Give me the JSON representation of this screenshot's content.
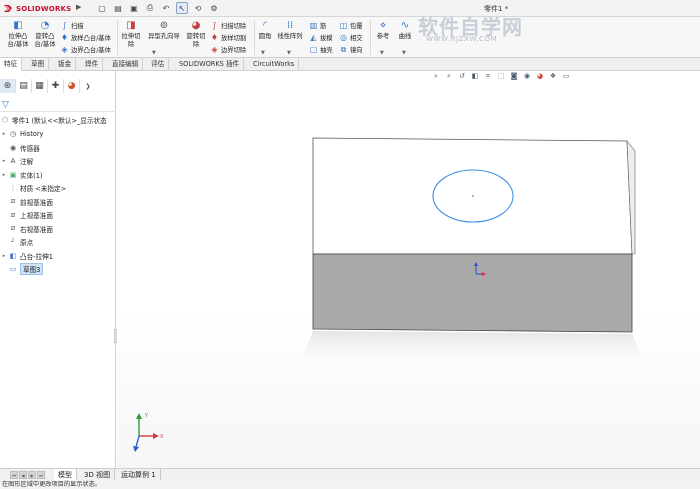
{
  "app": {
    "brand_prefix": "3S",
    "brand_name": "SOLIDWORKS",
    "document_title": "零件1 *"
  },
  "watermark": {
    "title": "软件自学网",
    "url": "WWW.RJZXW.COM"
  },
  "ribbon": {
    "extrude_boss": "拉伸凸\n台/基体",
    "revolve_boss": "旋转凸\n台/基体",
    "sweep": "扫描",
    "loft_boss": "放样凸台/基体",
    "boundary_boss": "边界凸台/基体",
    "extrude_cut": "拉伸切\n除",
    "hole_wizard": "异型孔向导",
    "revolve_cut": "旋转切\n除",
    "swept_cut": "扫描切除",
    "lofted_cut": "放样切割",
    "boundary_cut": "边界切除",
    "fillet": "圆角",
    "linear_pattern": "线性阵列",
    "rib": "筋",
    "draft": "拔模",
    "shell": "抽壳",
    "wrap": "包覆",
    "intersect": "相交",
    "mirror": "镜向",
    "reference": "参考",
    "curves": "曲线"
  },
  "tabs": [
    "特征",
    "草图",
    "钣金",
    "焊件",
    "直接编辑",
    "评估",
    "SOLIDWORKS 插件",
    "CircuitWorks"
  ],
  "tree": {
    "root": "零件1 (默认<<默认>_显示状态",
    "items": [
      {
        "label": "History",
        "icon": "history-icon",
        "expandable": true
      },
      {
        "label": "传感器",
        "icon": "sensor-icon",
        "expandable": false
      },
      {
        "label": "注解",
        "icon": "annotation-icon",
        "expandable": true
      },
      {
        "label": "实体(1)",
        "icon": "solid-body-icon",
        "expandable": true
      },
      {
        "label": "材质 <未指定>",
        "icon": "material-icon",
        "expandable": false
      },
      {
        "label": "前视基准面",
        "icon": "plane-icon",
        "expandable": false
      },
      {
        "label": "上视基准面",
        "icon": "plane-icon",
        "expandable": false
      },
      {
        "label": "右视基准面",
        "icon": "plane-icon",
        "expandable": false
      },
      {
        "label": "原点",
        "icon": "origin-icon",
        "expandable": false
      },
      {
        "label": "凸台-拉伸1",
        "icon": "extrude-feature-icon",
        "expandable": true
      },
      {
        "label": "草图3",
        "icon": "sketch-icon",
        "expandable": false,
        "selected": true
      }
    ]
  },
  "bottom_tabs": [
    "模型",
    "3D 视图",
    "运动算例 1"
  ],
  "status": {
    "message": "在图形区域中更改项目的显示状态。"
  },
  "colors": {
    "brand_red": "#c8102e",
    "sketch_blue": "#3d8ee0",
    "selection_blue": "#cfe3f7",
    "box_face_gray": "#a9a9a9"
  }
}
